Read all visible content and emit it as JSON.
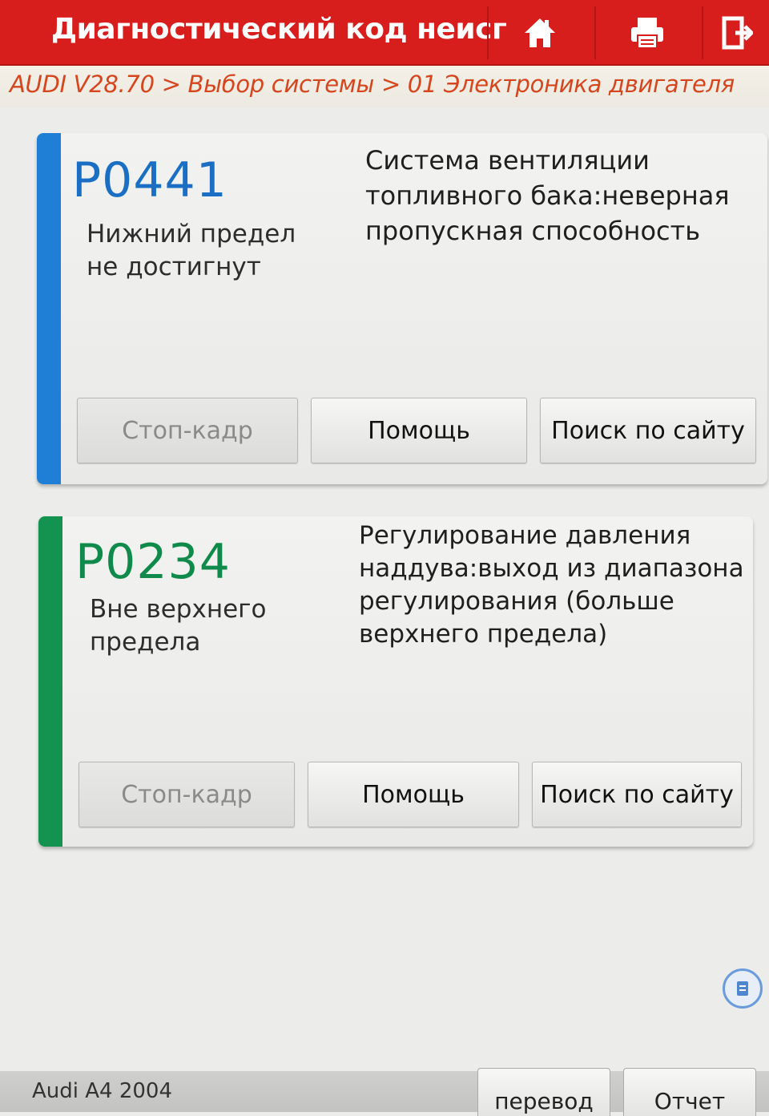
{
  "header": {
    "title": "Диагностический код неисг",
    "icons": [
      "home-icon",
      "printer-icon",
      "exit-icon"
    ],
    "color": "#d81d1d"
  },
  "breadcrumb": {
    "text": "AUDI V28.70 > Выбор системы > 01 Электроника двигателя",
    "color": "#d6461e"
  },
  "codes": [
    {
      "code": "P0441",
      "status": "Нижний предел не достигнут",
      "description": "Система вентиляции топливного бака:неверная пропускная способность",
      "accent": "#1f7fd6",
      "buttons": {
        "freeze": "Стоп-кадр",
        "help": "Помощь",
        "search": "Поиск по сайту"
      }
    },
    {
      "code": "P0234",
      "status": "Вне верхнего предела",
      "description": "Регулирование давления наддува:выход из диапазона регулирования (больше верхнего предела)",
      "accent": "#14924f",
      "buttons": {
        "freeze": "Стоп-кадр",
        "help": "Помощь",
        "search": "Поиск по сайту"
      }
    }
  ],
  "footer": {
    "vehicle": "Audi A4 2004",
    "translate": "перевод",
    "report": "Отчет"
  }
}
